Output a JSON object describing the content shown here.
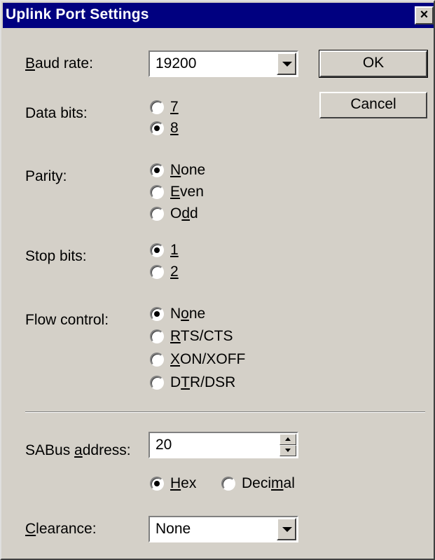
{
  "window": {
    "title": "Uplink Port Settings",
    "close_glyph": "×"
  },
  "baud_rate": {
    "label_key": "B",
    "label_rest": "aud rate:",
    "value": "19200"
  },
  "buttons": {
    "ok": "OK",
    "cancel": "Cancel"
  },
  "data_bits": {
    "label": "Data bits:",
    "options": [
      {
        "label": "7",
        "selected": false
      },
      {
        "label": "8",
        "selected": true
      }
    ]
  },
  "parity": {
    "label": "Parity:",
    "options": [
      {
        "pre": "",
        "key": "N",
        "post": "one",
        "selected": true
      },
      {
        "pre": "",
        "key": "E",
        "post": "ven",
        "selected": false
      },
      {
        "pre": "O",
        "key": "d",
        "post": "d",
        "selected": false
      }
    ]
  },
  "stop_bits": {
    "label": "Stop bits:",
    "options": [
      {
        "label": "1",
        "selected": true
      },
      {
        "label": "2",
        "selected": false
      }
    ]
  },
  "flow_control": {
    "label": "Flow control:",
    "options": [
      {
        "pre": "N",
        "key": "o",
        "post": "ne",
        "selected": true
      },
      {
        "pre": "",
        "key": "R",
        "post": "TS/CTS",
        "selected": false
      },
      {
        "pre": "",
        "key": "X",
        "post": "ON/XOFF",
        "selected": false
      },
      {
        "pre": "D",
        "key": "T",
        "post": "R/DSR",
        "selected": false
      }
    ]
  },
  "sabus": {
    "label_pre": "SABus ",
    "label_key": "a",
    "label_post": "ddress:",
    "value": "20",
    "hex": {
      "key": "H",
      "post": "ex",
      "selected": true
    },
    "decimal": {
      "pre": "Deci",
      "key": "m",
      "post": "al",
      "selected": false
    }
  },
  "clearance": {
    "label_key": "C",
    "label_rest": "learance:",
    "value": "None"
  }
}
